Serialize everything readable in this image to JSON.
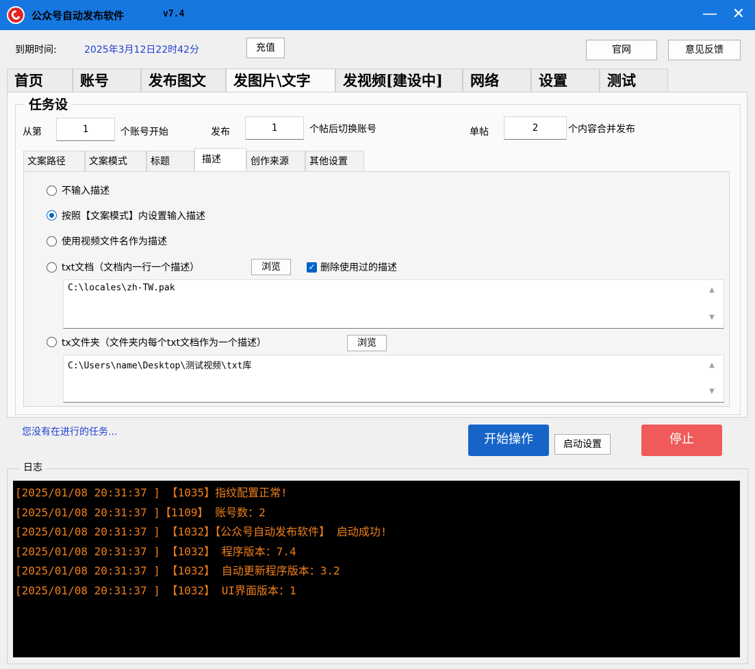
{
  "window": {
    "title": "公众号自动发布软件",
    "version": "v7.4",
    "minimize": "—",
    "close": "✕"
  },
  "header": {
    "expiry_label": "到期时间:",
    "expiry_value": "2025年3月12日22时42分",
    "recharge": "充值",
    "official_site": "官网",
    "feedback": "意见反馈"
  },
  "main_tabs": [
    "首页",
    "账号",
    "发布图文",
    "发图片\\文字",
    "发视频[建设中]",
    "网络",
    "设置",
    "测试"
  ],
  "task_settings": {
    "title": "任务设",
    "from_label": "从第",
    "from_value": "1",
    "from_suffix": "个账号开始",
    "publish_label": "发布",
    "publish_value": "1",
    "publish_suffix": "个帖后切换账号",
    "single_label": "单帖",
    "single_value": "2",
    "single_suffix": "个内容合并发布"
  },
  "sub_tabs": [
    "文案路径",
    "文案模式",
    "标题",
    "描述",
    "创作来源",
    "其他设置"
  ],
  "description": {
    "opt_none": "不输入描述",
    "opt_mode": "按照【文案模式】内设置输入描述",
    "opt_filename": "使用视频文件名作为描述",
    "opt_txt": "txt文档（文档内一行一个描述）",
    "browse": "浏览",
    "delete_used": "删除使用过的描述",
    "txt_path": "C:\\locales\\zh-TW.pak",
    "opt_folder": "tx文件夹（文件夹内每个txt文档作为一个描述）",
    "folder_path": "C:\\Users\\name\\Desktop\\测试视频\\txt库"
  },
  "status": "您没有在进行的任务...",
  "actions": {
    "start": "开始操作",
    "startup_settings": "启动设置",
    "stop": "停止"
  },
  "log": {
    "title": "日志",
    "lines": [
      "[2025/01/08 20:31:37 ] 【1035】指纹配置正常!",
      "[2025/01/08 20:31:37 ]【1109】 账号数：2",
      "[2025/01/08 20:31:37 ] 【1032】【公众号自动发布软件】 启动成功!",
      "[2025/01/08 20:31:37 ] 【1032】 程序版本：7.4",
      "[2025/01/08 20:31:37 ] 【1032】 自动更新程序版本：3.2",
      "[2025/01/08 20:31:37 ] 【1032】 UI界面版本：1"
    ]
  },
  "colors": {
    "titlebar": "#1677e0",
    "start_button": "#1764c9",
    "stop_button": "#f05a5a",
    "log_text": "#f07f1a"
  }
}
